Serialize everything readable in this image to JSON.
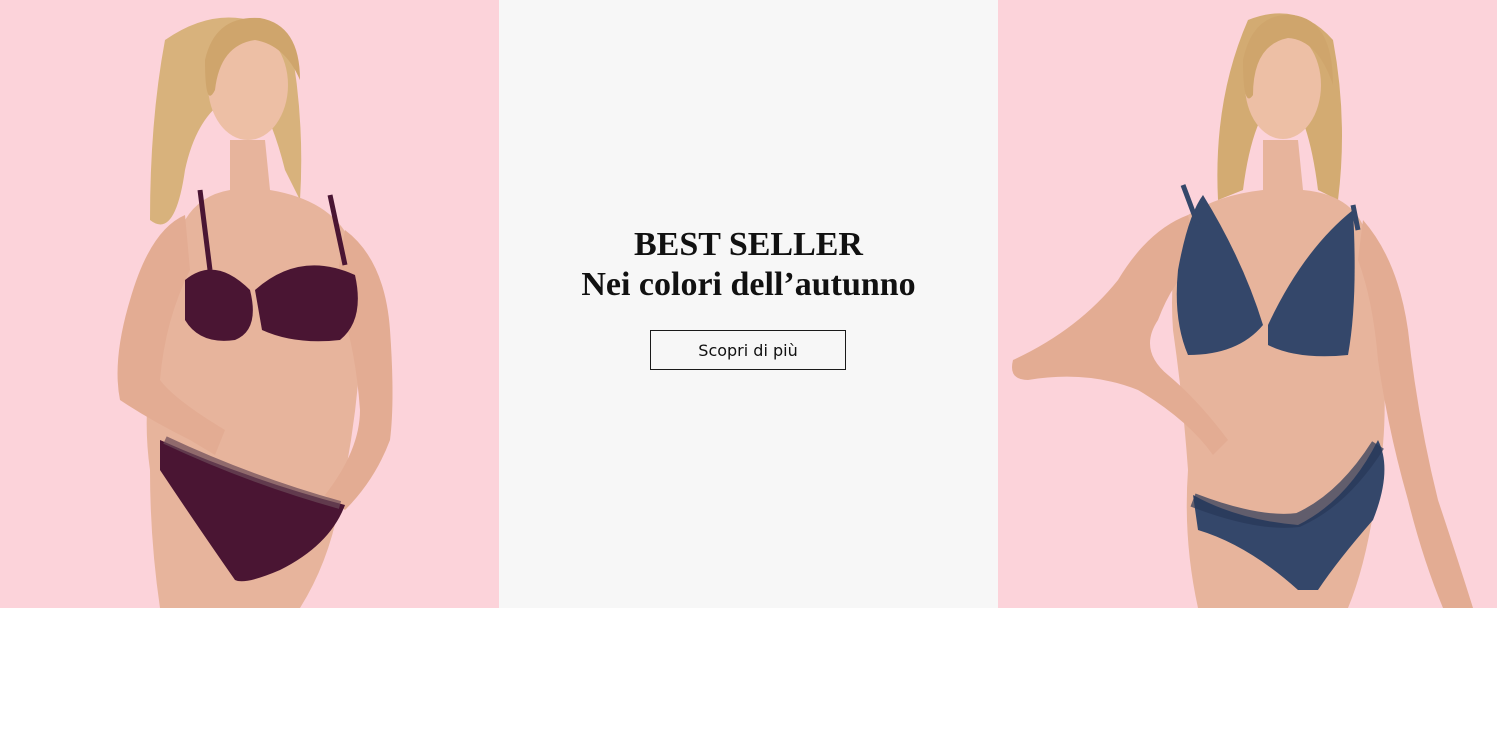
{
  "banner": {
    "headline": "BEST SELLER",
    "subheadline": "Nei colori dell’autunno",
    "cta_label": "Scopri di più"
  },
  "colors": {
    "backdrop_pink": "#fcd3da",
    "center_panel": "#f7f7f7",
    "plum_lingerie": "#4a1533",
    "navy_lingerie": "#34476a",
    "text": "#111111"
  },
  "images": {
    "left": "model-plum-lingerie",
    "right": "model-navy-lace-lingerie"
  }
}
